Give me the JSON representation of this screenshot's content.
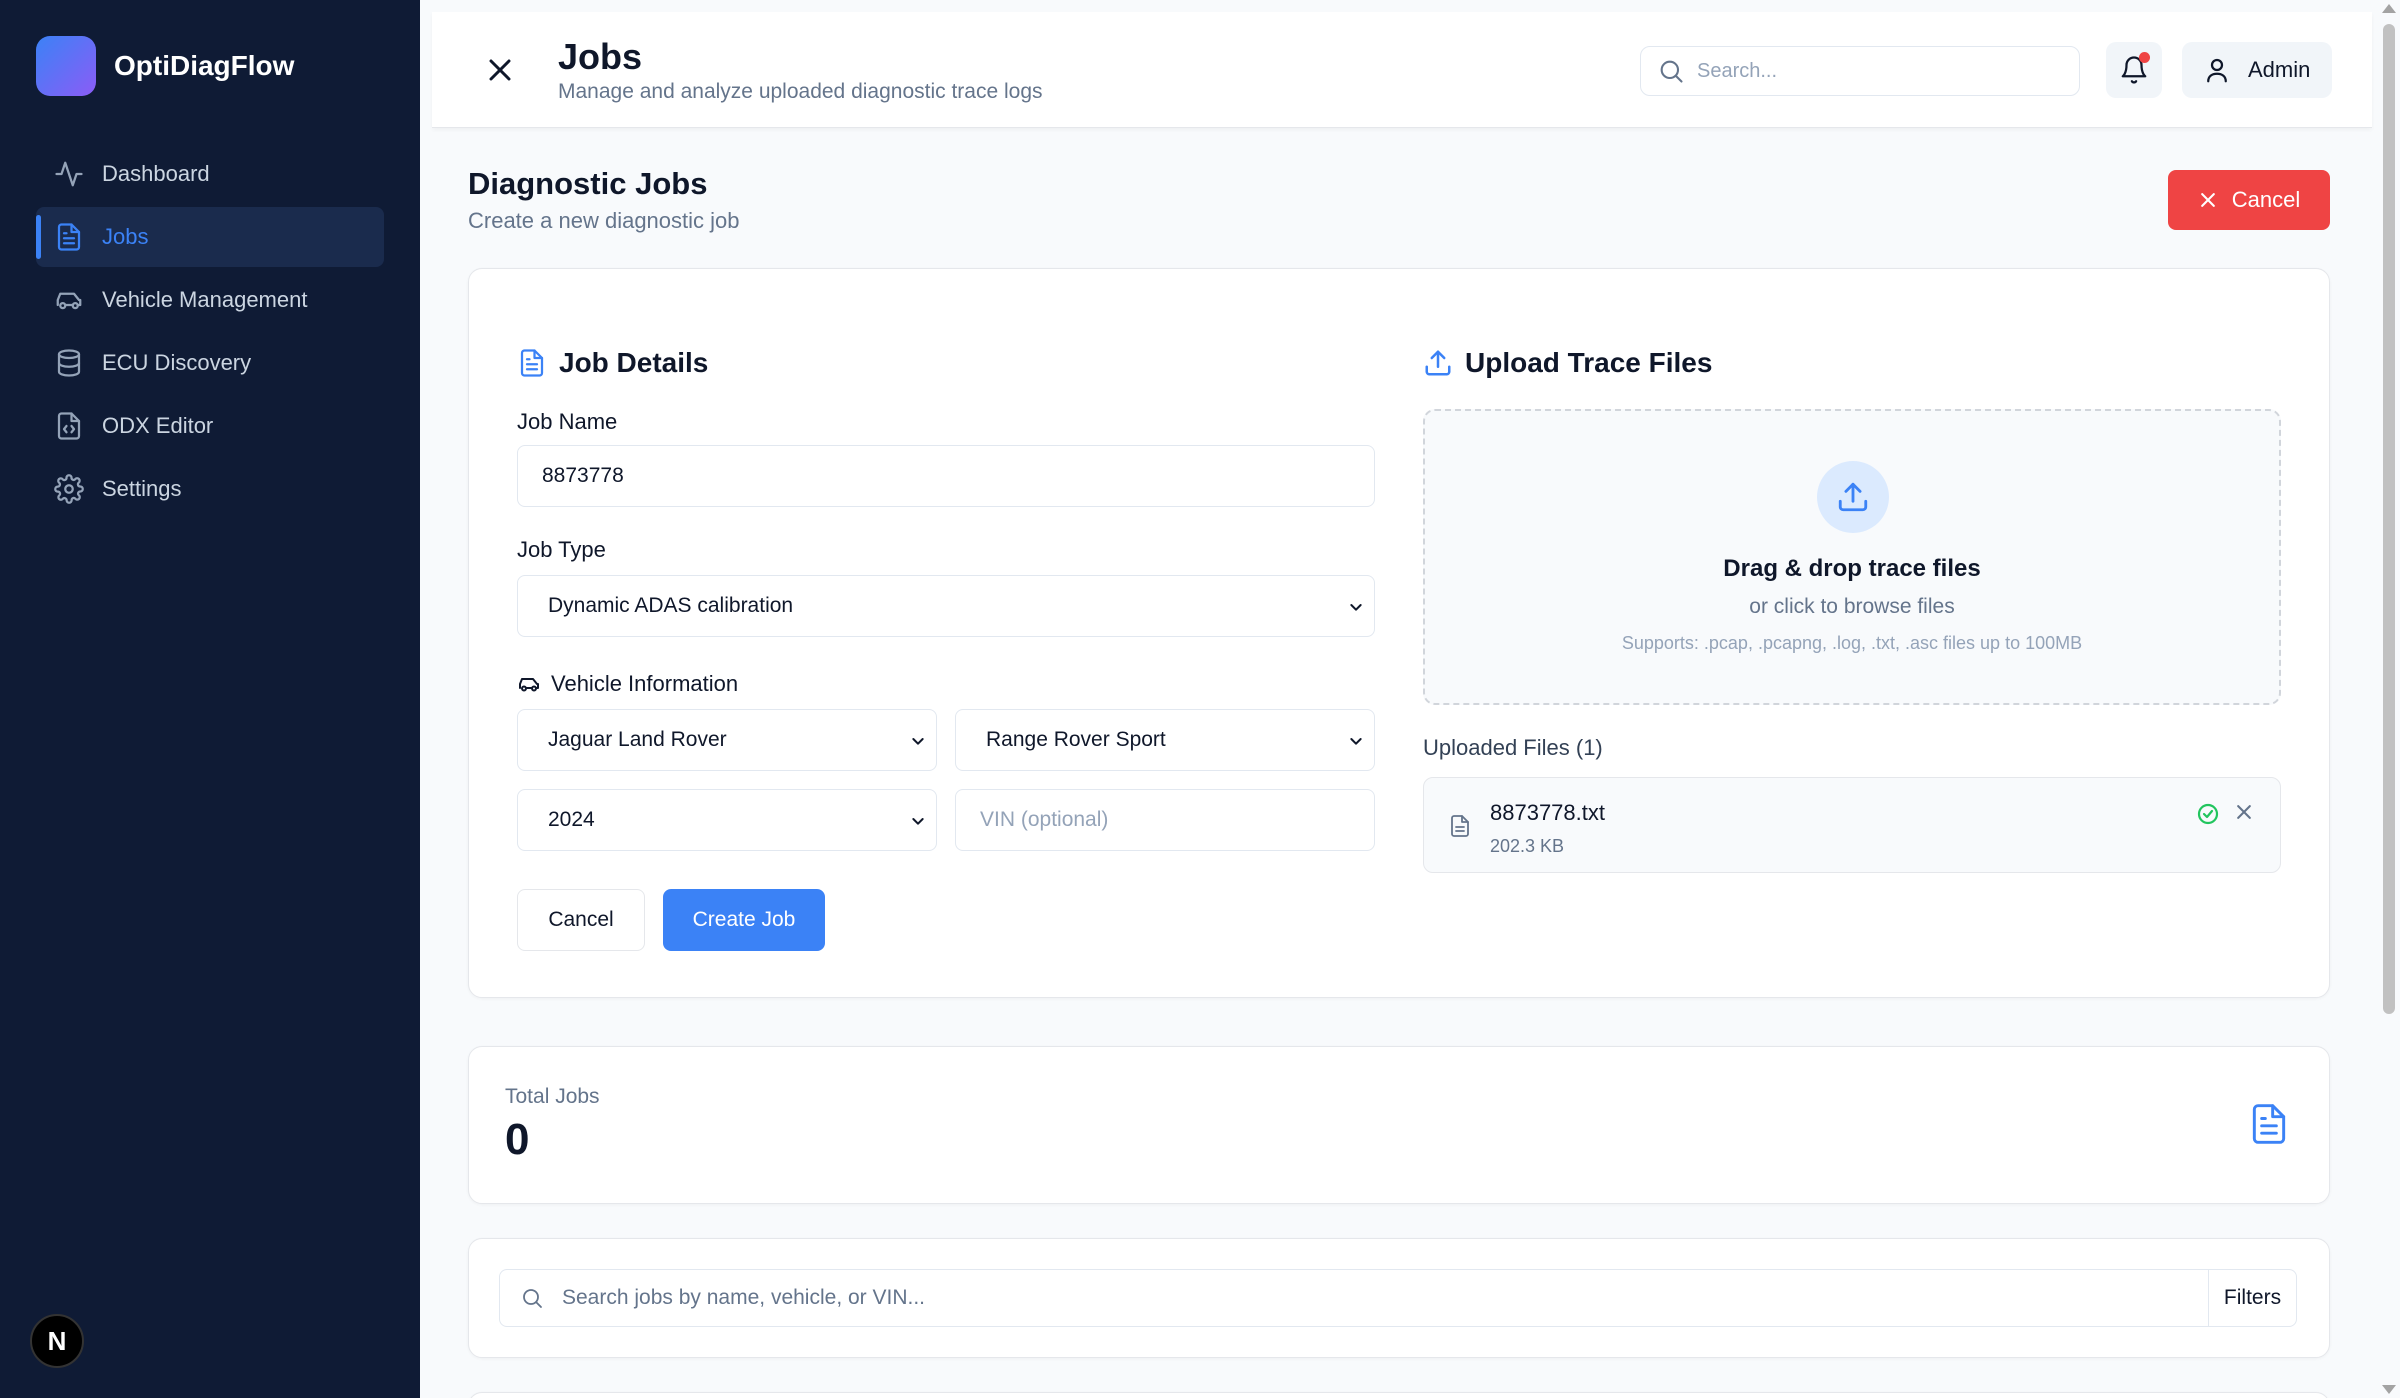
{
  "app": {
    "name": "OptiDiagFlow"
  },
  "sidebar": {
    "items": [
      {
        "label": "Dashboard",
        "icon": "activity-icon"
      },
      {
        "label": "Jobs",
        "icon": "file-text-icon",
        "active": true
      },
      {
        "label": "Vehicle Management",
        "icon": "car-icon"
      },
      {
        "label": "ECU Discovery",
        "icon": "database-icon"
      },
      {
        "label": "ODX Editor",
        "icon": "file-code-icon"
      },
      {
        "label": "Settings",
        "icon": "gear-icon"
      }
    ],
    "bottom_badge": "N"
  },
  "header": {
    "title": "Jobs",
    "subtitle": "Manage and analyze uploaded diagnostic trace logs",
    "search_placeholder": "Search...",
    "user_label": "Admin"
  },
  "section": {
    "title": "Diagnostic Jobs",
    "subtitle": "Create a new diagnostic job",
    "cancel_label": "Cancel"
  },
  "job_details": {
    "title": "Job Details",
    "job_name_label": "Job Name",
    "job_name_value": "8873778",
    "job_type_label": "Job Type",
    "job_type_value": "Dynamic ADAS calibration",
    "vehicle_info_label": "Vehicle Information",
    "make_value": "Jaguar Land Rover",
    "model_value": "Range Rover Sport",
    "year_value": "2024",
    "vin_placeholder": "VIN (optional)",
    "cancel_label": "Cancel",
    "create_label": "Create Job"
  },
  "upload": {
    "title": "Upload Trace Files",
    "drop_title": "Drag & drop trace files",
    "drop_sub": "or click to browse files",
    "drop_note": "Supports: .pcap, .pcapng, .log, .txt, .asc files up to 100MB",
    "uploaded_label": "Uploaded Files (1)",
    "files": [
      {
        "name": "8873778.txt",
        "size": "202.3 KB"
      }
    ]
  },
  "stats": {
    "total_label": "Total Jobs",
    "total_value": "0"
  },
  "job_search": {
    "placeholder": "Search jobs by name, vehicle, or VIN...",
    "filters_label": "Filters"
  },
  "colors": {
    "sidebar_bg": "#0f1b35",
    "accent": "#3b82f6",
    "danger": "#ef4444",
    "success": "#22c55e"
  }
}
